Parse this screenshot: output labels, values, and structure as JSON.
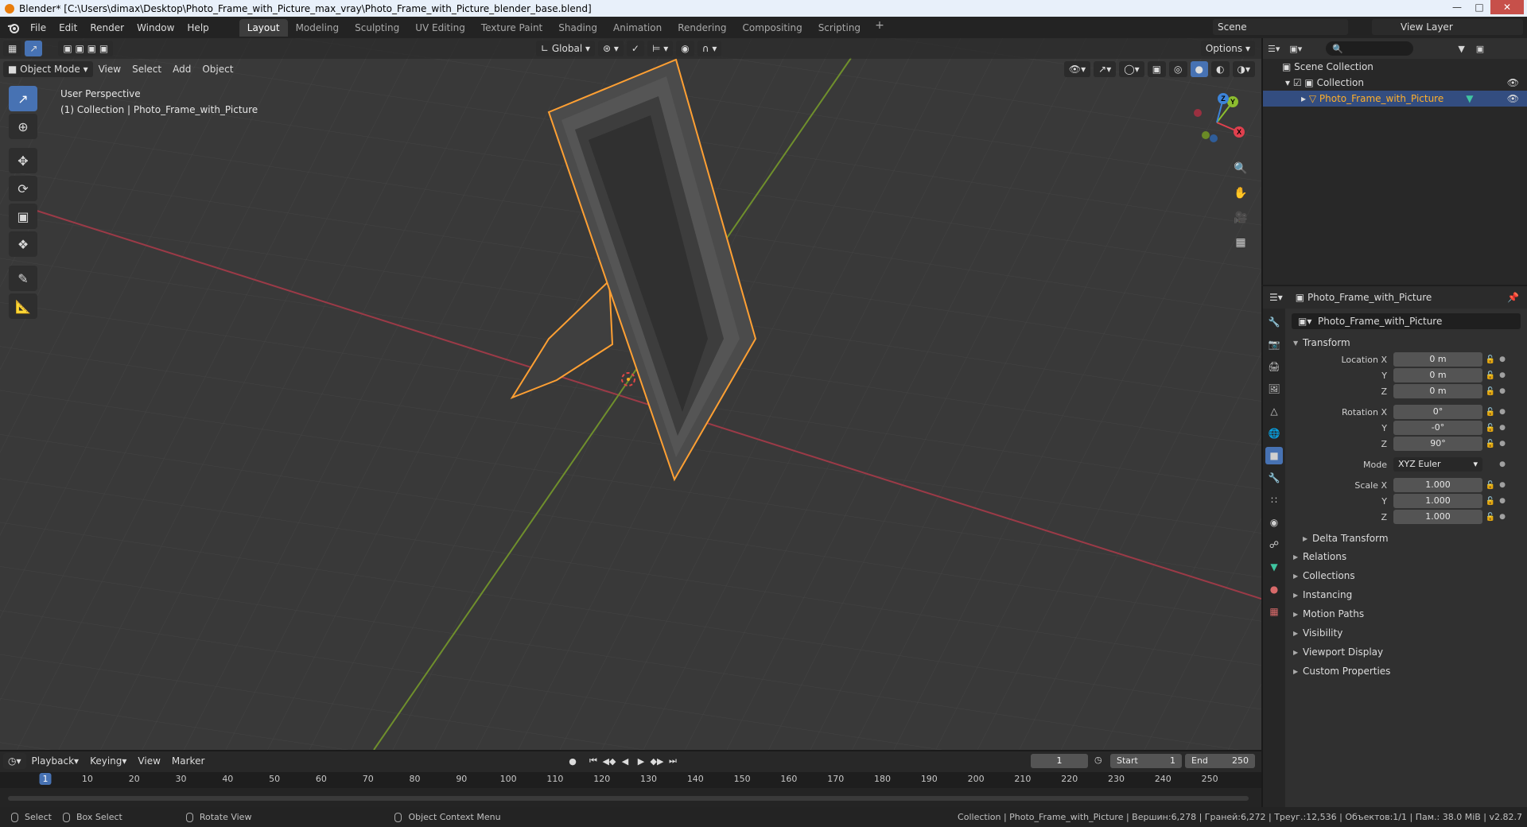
{
  "window": {
    "title": "Blender* [C:\\Users\\dimax\\Desktop\\Photo_Frame_with_Picture_max_vray\\Photo_Frame_with_Picture_blender_base.blend]"
  },
  "menu": {
    "items": [
      "File",
      "Edit",
      "Render",
      "Window",
      "Help"
    ]
  },
  "workspaces": {
    "tabs": [
      "Layout",
      "Modeling",
      "Sculpting",
      "UV Editing",
      "Texture Paint",
      "Shading",
      "Animation",
      "Rendering",
      "Compositing",
      "Scripting"
    ],
    "active": "Layout",
    "add_label": "+"
  },
  "scene": {
    "name": "Scene"
  },
  "view_layer": {
    "name": "View Layer"
  },
  "viewport": {
    "transform_orientation": "Global",
    "options_label": "Options",
    "mode": "Object Mode",
    "menus": [
      "View",
      "Select",
      "Add",
      "Object"
    ],
    "perspective_label": "User Perspective",
    "collection_info": "(1) Collection | Photo_Frame_with_Picture",
    "gizmo_axes": {
      "x": "X",
      "y": "Y",
      "z": "Z"
    }
  },
  "outliner": {
    "search_placeholder": "",
    "rows": [
      {
        "label": "Scene Collection"
      },
      {
        "label": "Collection"
      },
      {
        "label": "Photo_Frame_with_Picture",
        "selected": true
      }
    ]
  },
  "properties": {
    "object_name": "Photo_Frame_with_Picture",
    "data_name": "Photo_Frame_with_Picture",
    "transform": {
      "title": "Transform",
      "location": {
        "label_x": "Location X",
        "x": "0 m",
        "y": "0 m",
        "z": "0 m"
      },
      "rotation": {
        "label_x": "Rotation X",
        "x": "0°",
        "y": "-0°",
        "z": "90°"
      },
      "mode_label": "Mode",
      "mode_value": "XYZ Euler",
      "scale": {
        "label_x": "Scale X",
        "x": "1.000",
        "y": "1.000",
        "z": "1.000"
      },
      "axis_y": "Y",
      "axis_z": "Z"
    },
    "delta_transform": "Delta Transform",
    "panels": [
      "Relations",
      "Collections",
      "Instancing",
      "Motion Paths",
      "Visibility",
      "Viewport Display",
      "Custom Properties"
    ]
  },
  "timeline": {
    "menus": [
      "Playback",
      "Keying",
      "View",
      "Marker"
    ],
    "current_frame": "1",
    "start_label": "Start",
    "start_value": "1",
    "end_label": "End",
    "end_value": "250",
    "ticks": [
      "1",
      "10",
      "20",
      "30",
      "40",
      "50",
      "60",
      "70",
      "80",
      "90",
      "100",
      "110",
      "120",
      "130",
      "140",
      "150",
      "160",
      "170",
      "180",
      "190",
      "200",
      "210",
      "220",
      "230",
      "240",
      "250"
    ]
  },
  "statusbar": {
    "select": "Select",
    "box_select": "Box Select",
    "rotate_view": "Rotate View",
    "context_menu": "Object Context Menu",
    "stats": "Collection | Photo_Frame_with_Picture | Вершин:6,278 | Граней:6,272 | Треуг.:12,536 | Объектов:1/1 | Пам.: 38.0 MiB | v2.82.7"
  },
  "colors": {
    "accent": "#4772b3",
    "selection_outline": "#ffa033",
    "x_axis": "#b3384a",
    "y_axis": "#6c9a1e",
    "viewport_bg": "#3a3a3a"
  }
}
